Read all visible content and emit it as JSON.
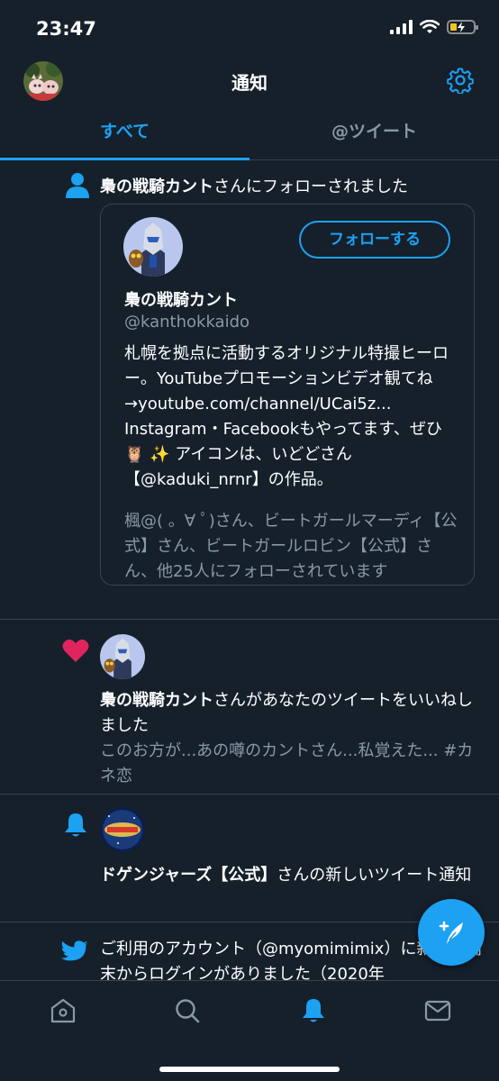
{
  "status_bar": {
    "time": "23:47"
  },
  "header": {
    "title": "通知"
  },
  "tabs": [
    {
      "label": "すべて",
      "active": true
    },
    {
      "label": "@ツイート",
      "active": false
    }
  ],
  "notifications": {
    "follow": {
      "actor": "梟の戦騎カント",
      "suffix": "さんにフォローされました",
      "card": {
        "follow_button": "フォローする",
        "name": "梟の戦騎カント",
        "handle": "@kanthokkaido",
        "bio": "札幌を拠点に活動するオリジナル特撮ヒーロー。YouTubeプロモーションビデオ観てね→youtube.com/channel/UCai5z... Instagram・Facebookもやってます、ぜひ 🦉 ✨ アイコンは、いどどさん 【@kaduki_nrnr】の作品。",
        "followed_by": "楓@( 。∀ ﾟ)さん、ビートガールマーディ【公式】さん、ビートガールロビン【公式】さん、他25人にフォローされています"
      }
    },
    "like": {
      "actor": "梟の戦騎カント",
      "suffix": "さんがあなたのツイートをいいねしました",
      "tweet_preview": "このお方が...あの噂のカントさん...私覚えた... #カネ恋"
    },
    "tweet_notice": {
      "actor": "ドゲンジャーズ【公式】",
      "suffix": "さんの新しいツイート通知"
    },
    "login": {
      "text": "ご利用のアカウント（@myomimimix）に新しい端末からログインがありました（2020年"
    }
  },
  "colors": {
    "background": "#15202b",
    "accent": "#1da1f2",
    "like": "#e0245e",
    "secondary_text": "#8899a6",
    "divider": "#38444d"
  },
  "icons": {
    "settings": "gear-icon",
    "follow": "person-icon",
    "like": "heart-icon",
    "tweet_notice": "bell-icon",
    "login": "twitter-bird-icon",
    "compose": "compose-tweet-icon",
    "nav": [
      "home-icon",
      "search-icon",
      "notifications-icon",
      "messages-icon"
    ]
  }
}
